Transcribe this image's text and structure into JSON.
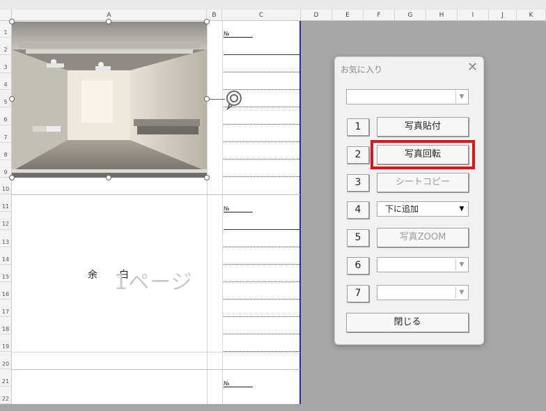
{
  "columns": [
    "A",
    "B",
    "C",
    "D",
    "E",
    "F",
    "G",
    "H",
    "I",
    "J",
    "K"
  ],
  "rows": [
    "1",
    "2",
    "3",
    "4",
    "5",
    "6",
    "7",
    "8",
    "9",
    "10",
    "11",
    "12",
    "13",
    "14",
    "15",
    "16",
    "17",
    "18",
    "19",
    "20",
    "21",
    "22"
  ],
  "sheet": {
    "no_label": "№",
    "margin_text_left": "余",
    "margin_text_right": "白",
    "page_label": "1ページ"
  },
  "dialog": {
    "title": "お気に入り",
    "close_glyph": "✕",
    "top_combo_value": "",
    "buttons": [
      {
        "num": "1",
        "label": "写真貼付",
        "enabled": true
      },
      {
        "num": "2",
        "label": "写真回転",
        "enabled": true
      },
      {
        "num": "3",
        "label": "シートコピー",
        "enabled": false
      },
      {
        "num": "4",
        "label": "下に追加",
        "enabled": true,
        "type": "combo"
      },
      {
        "num": "5",
        "label": "写真ZOOM",
        "enabled": false
      },
      {
        "num": "6",
        "label": "",
        "enabled": true,
        "type": "combo"
      },
      {
        "num": "7",
        "label": "",
        "enabled": true,
        "type": "combo"
      }
    ],
    "close_button": "閉じる",
    "arrow": "▼",
    "highlight_color": "#e01414"
  }
}
